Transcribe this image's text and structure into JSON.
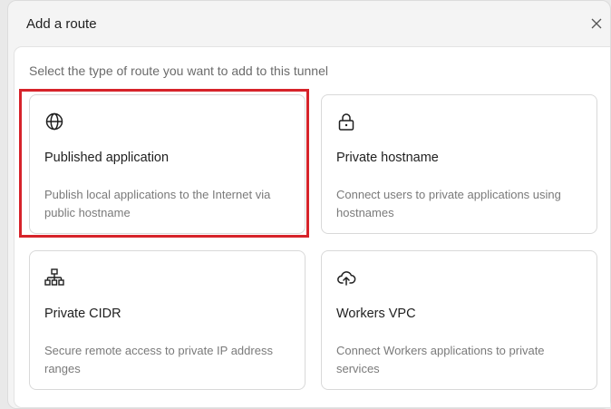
{
  "modal": {
    "title": "Add a route",
    "close_icon": "close-icon"
  },
  "body": {
    "prompt": "Select the type of route you want to add to this tunnel"
  },
  "cards": [
    {
      "icon": "globe-icon",
      "title": "Published application",
      "description": "Publish local applications to the Internet via public hostname"
    },
    {
      "icon": "lock-icon",
      "title": "Private hostname",
      "description": "Connect users to private applications using hostnames"
    },
    {
      "icon": "network-icon",
      "title": "Private CIDR",
      "description": "Secure remote access to private IP address ranges"
    },
    {
      "icon": "cloud-upload-icon",
      "title": "Workers VPC",
      "description": "Connect Workers applications to private services"
    }
  ],
  "colors": {
    "highlight": "#d6232a",
    "background": "#e9e9e9",
    "card_border": "#d9d9d9"
  }
}
